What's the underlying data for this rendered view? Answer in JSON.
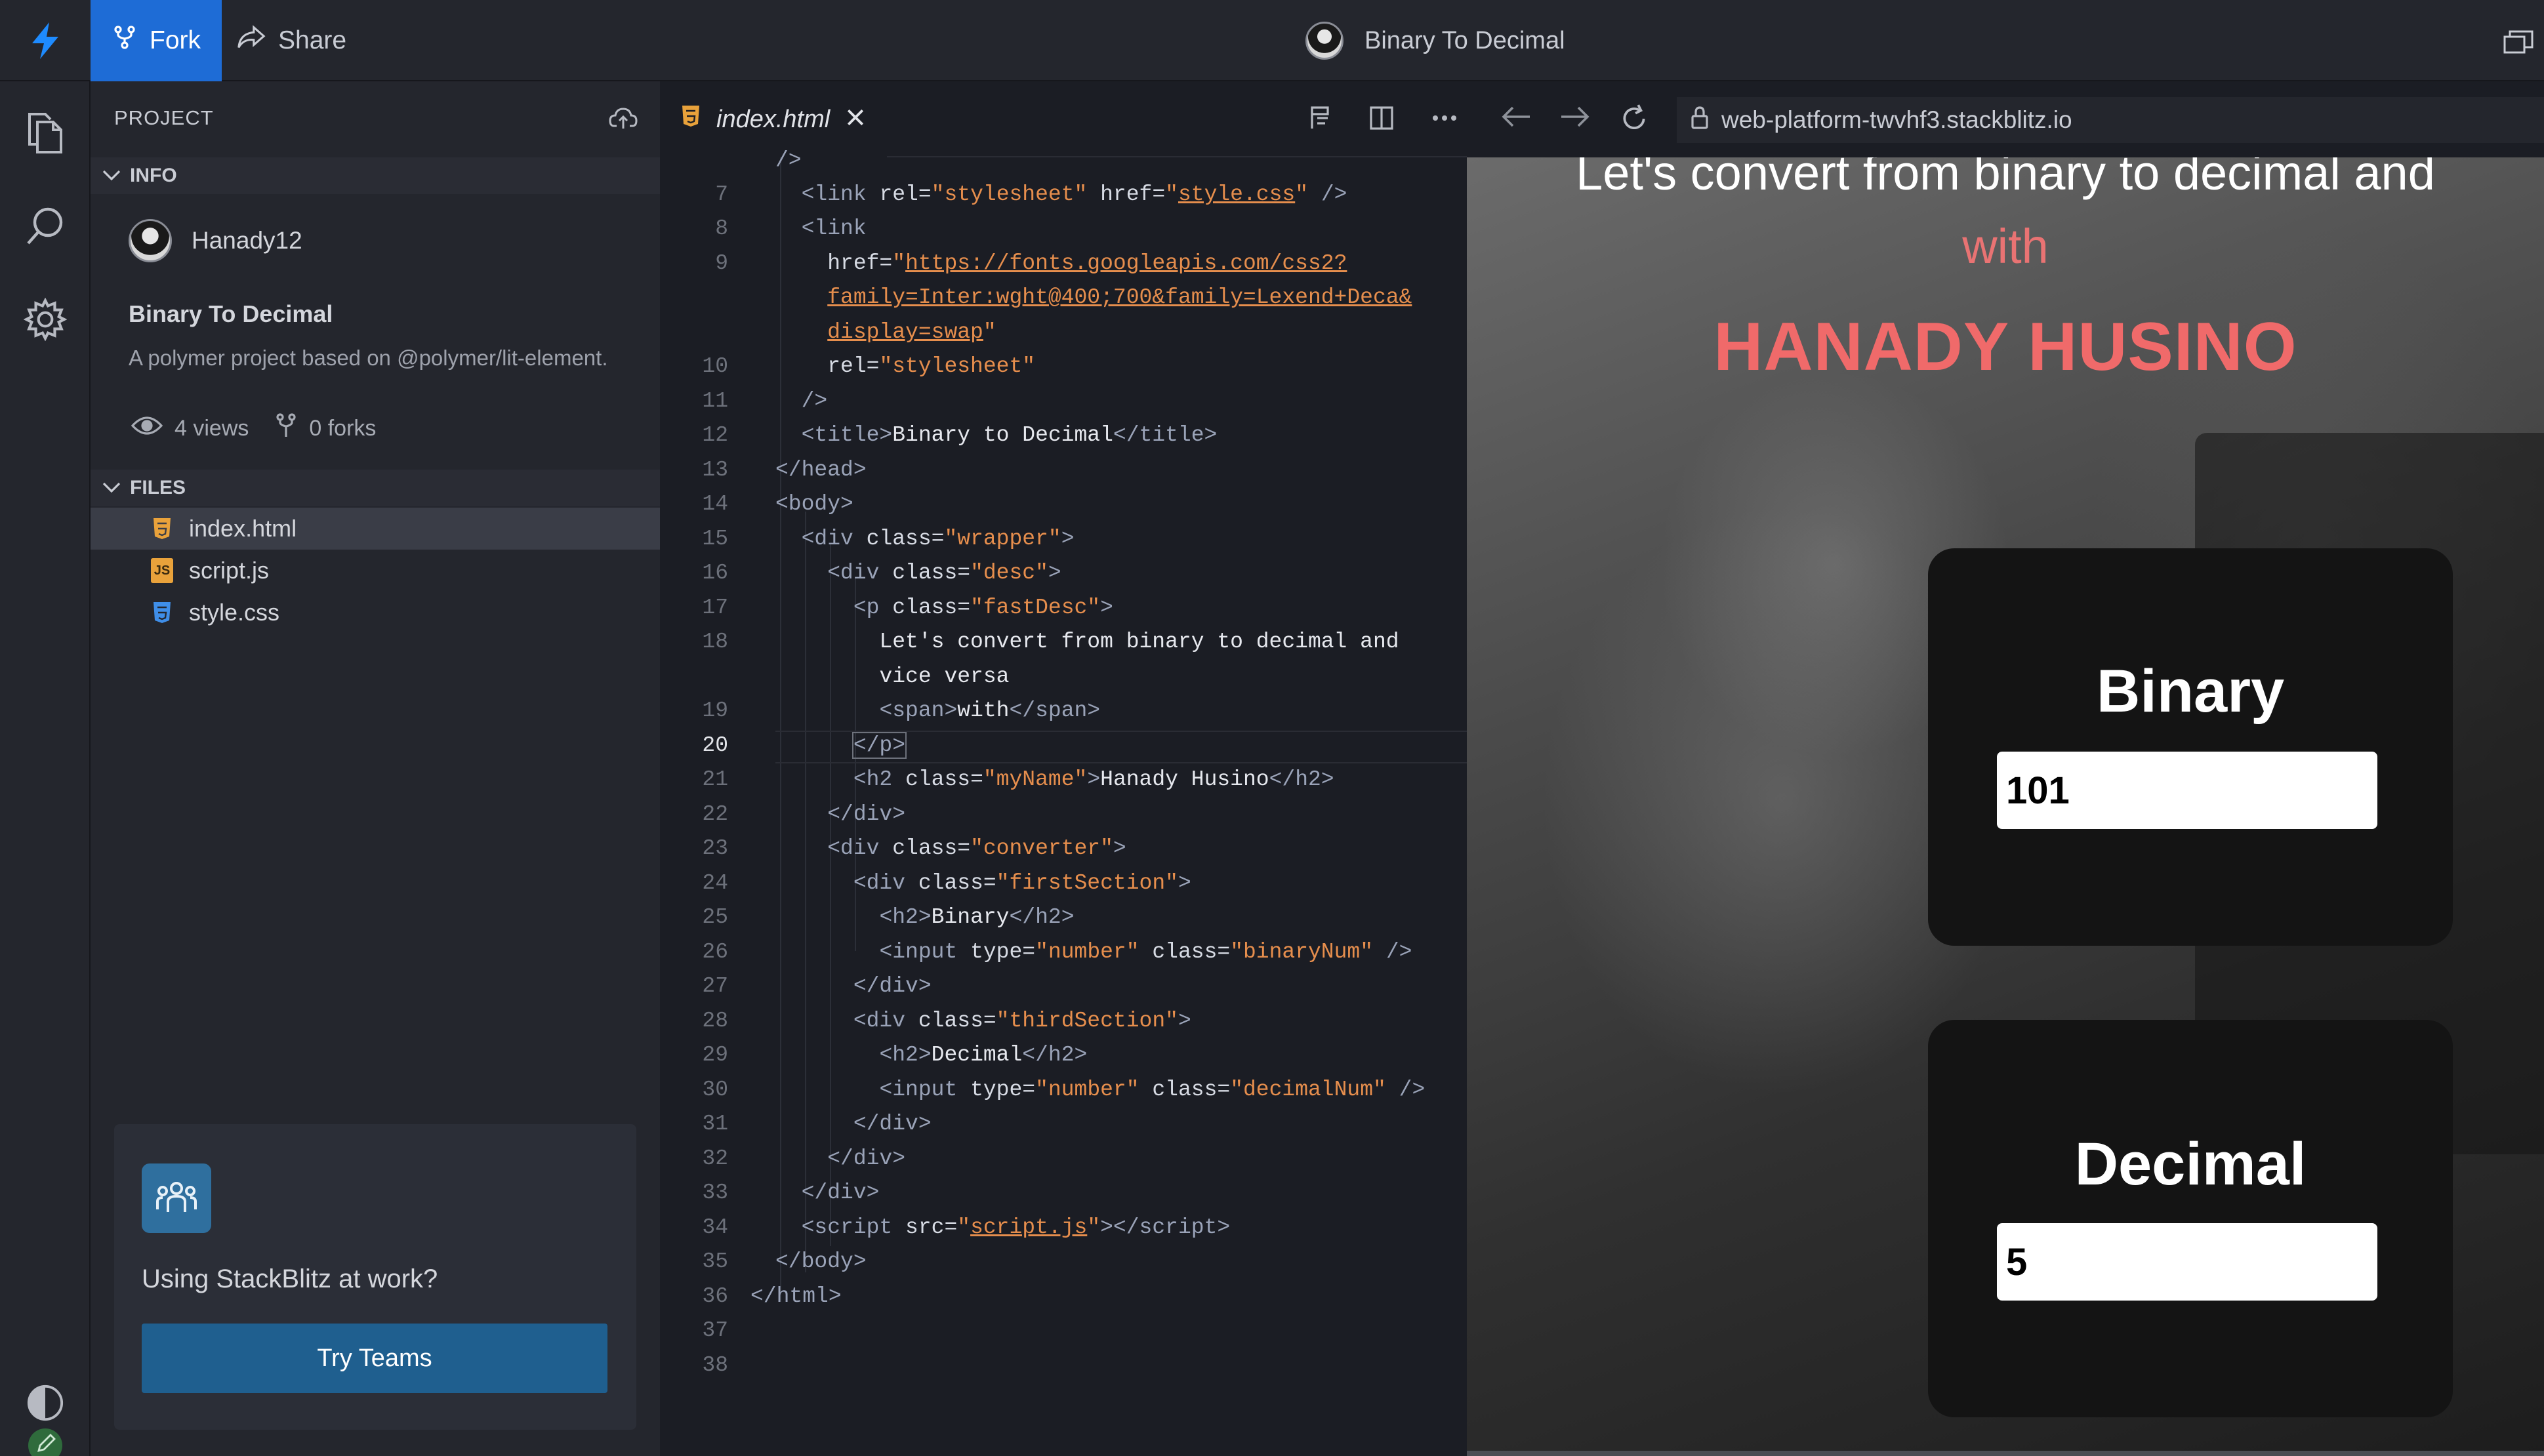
{
  "header": {
    "fork_label": "Fork",
    "share_label": "Share",
    "project_title": "Binary To Decimal"
  },
  "sidebar": {
    "project_heading": "PROJECT",
    "info_heading": "INFO",
    "author": "Hanady12",
    "project_name": "Binary To Decimal",
    "description": "A polymer project based on @polymer/lit-element.",
    "views": "4 views",
    "forks": "0 forks",
    "files_heading": "FILES",
    "files": [
      {
        "name": "index.html",
        "type": "html",
        "active": true
      },
      {
        "name": "script.js",
        "type": "js",
        "active": false
      },
      {
        "name": "style.css",
        "type": "css",
        "active": false
      }
    ],
    "promo_text": "Using StackBlitz at work?",
    "promo_button": "Try Teams"
  },
  "editor": {
    "tab_label": "index.html",
    "current_line": 20,
    "line_numbers": [
      "7",
      "8",
      "9",
      "",
      "",
      "10",
      "11",
      "12",
      "13",
      "14",
      "15",
      "16",
      "17",
      "18",
      "",
      "19",
      "20",
      "21",
      "22",
      "23",
      "24",
      "25",
      "26",
      "27",
      "28",
      "29",
      "30",
      "31",
      "32",
      "33",
      "34",
      "35",
      "36",
      "37",
      "38"
    ],
    "partial_top_line": "/>"
  },
  "preview": {
    "url": "web-platform-twvhf3.stackblitz.io",
    "fast_desc": "Let's convert from binary to decimal and",
    "with_text": "with",
    "my_name": "HANADY HUSINO",
    "binary_heading": "Binary",
    "binary_value": "101",
    "decimal_heading": "Decimal",
    "decimal_value": "5"
  },
  "colors": {
    "accent": "#1e6cd6",
    "name_red": "#f06a6a",
    "string_orange": "#e68e4d",
    "teams_button": "#1f5f8f"
  },
  "icons": [
    "bolt-icon",
    "fork-icon",
    "share-icon",
    "files-icon",
    "search-icon",
    "settings-icon",
    "theme-icon",
    "edit-icon",
    "upload-icon",
    "chevron-down-icon",
    "eye-icon",
    "html-file-icon",
    "js-file-icon",
    "css-file-icon",
    "team-icon",
    "close-icon",
    "format-icon",
    "split-icon",
    "more-icon",
    "back-icon",
    "forward-icon",
    "reload-icon",
    "lock-icon",
    "window-icon"
  ]
}
